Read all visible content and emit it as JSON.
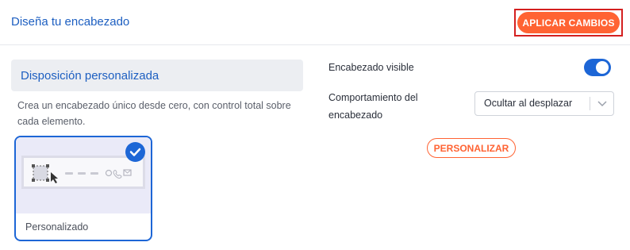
{
  "header": {
    "title": "Diseña tu encabezado",
    "apply_label": "APLICAR CAMBIOS"
  },
  "layout": {
    "section_title": "Disposición personalizada",
    "description": "Crea un encabezado único desde cero, con control total sobre cada elemento.",
    "card": {
      "label": "Personalizado",
      "selected": true
    }
  },
  "settings": {
    "visible_label": "Encabezado visible",
    "visible_on": true,
    "behavior_label": "Comportamiento del encabezado",
    "behavior_value": "Ocultar al desplazar",
    "customize_label": "PERSONALIZAR"
  },
  "colors": {
    "accent": "#1d66d6",
    "cta": "#ff6333",
    "highlight_frame": "#d42020"
  },
  "icons": [
    "check-icon",
    "chevron-down-icon",
    "cursor-icon",
    "chat-icon",
    "phone-icon",
    "mail-icon",
    "toggle-switch"
  ]
}
